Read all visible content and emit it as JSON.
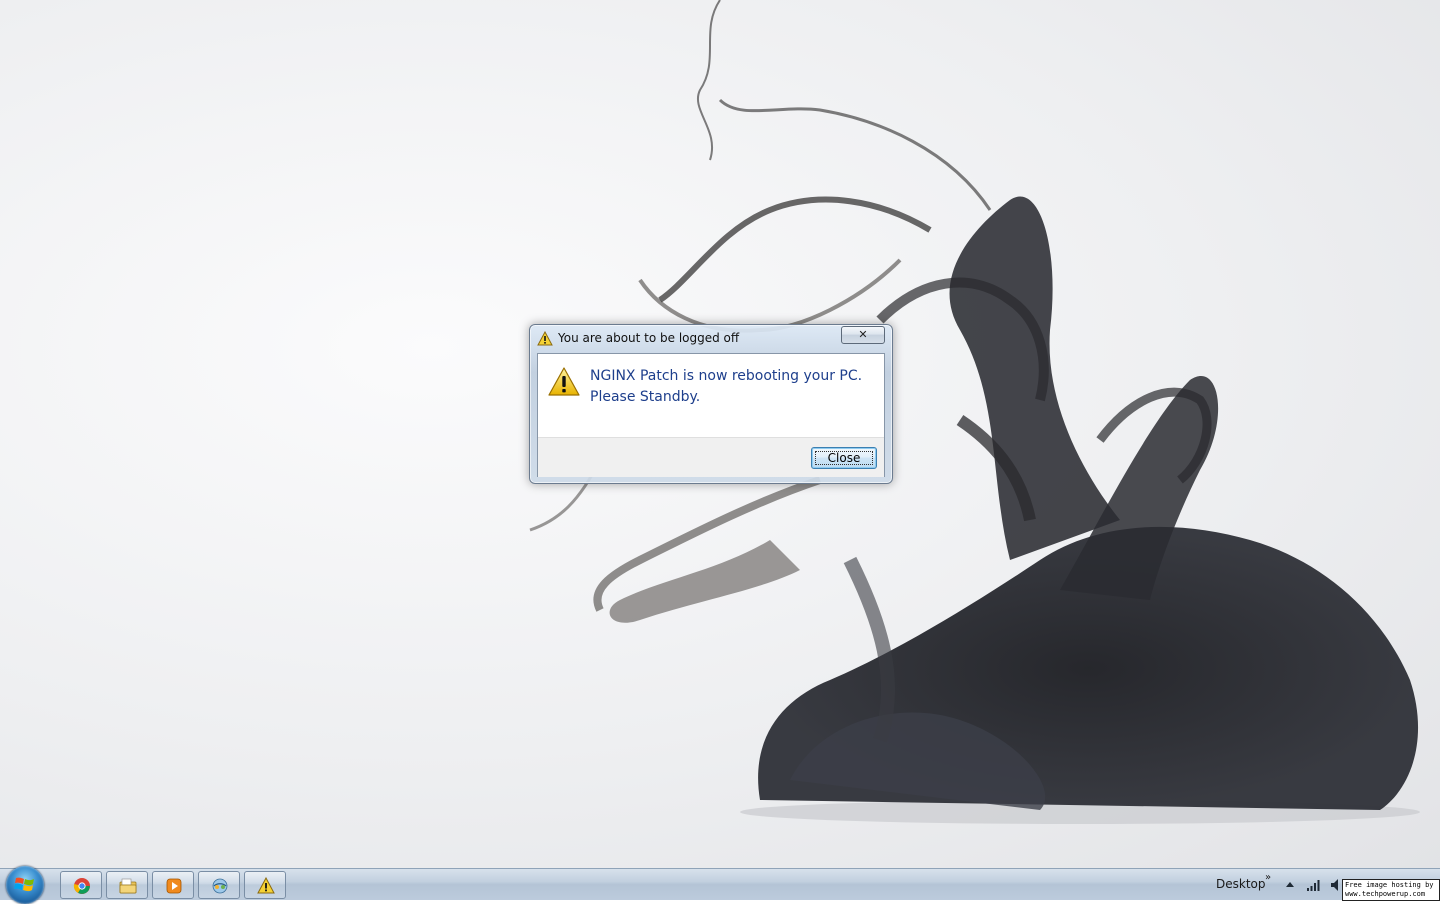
{
  "dialog": {
    "title": "You are about to be logged off",
    "close_x_label": "✕",
    "message_line_1": "NGINX Patch is now rebooting your PC.",
    "message_line_2": "Please Standby.",
    "close_button_label": "Close",
    "message_color": "#1e3f8c"
  },
  "taskbar": {
    "start_icon": "windows-logo-icon",
    "buttons": [
      {
        "icon": "chrome-icon"
      },
      {
        "icon": "file-explorer-icon"
      },
      {
        "icon": "media-player-icon"
      },
      {
        "icon": "network-app-icon"
      },
      {
        "icon": "warning-icon"
      }
    ],
    "toolbar_label": "Desktop",
    "toolbar_chevron": "»",
    "watermark_line_1": "Free image hosting by",
    "watermark_line_2": "www.techpowerup.com"
  }
}
